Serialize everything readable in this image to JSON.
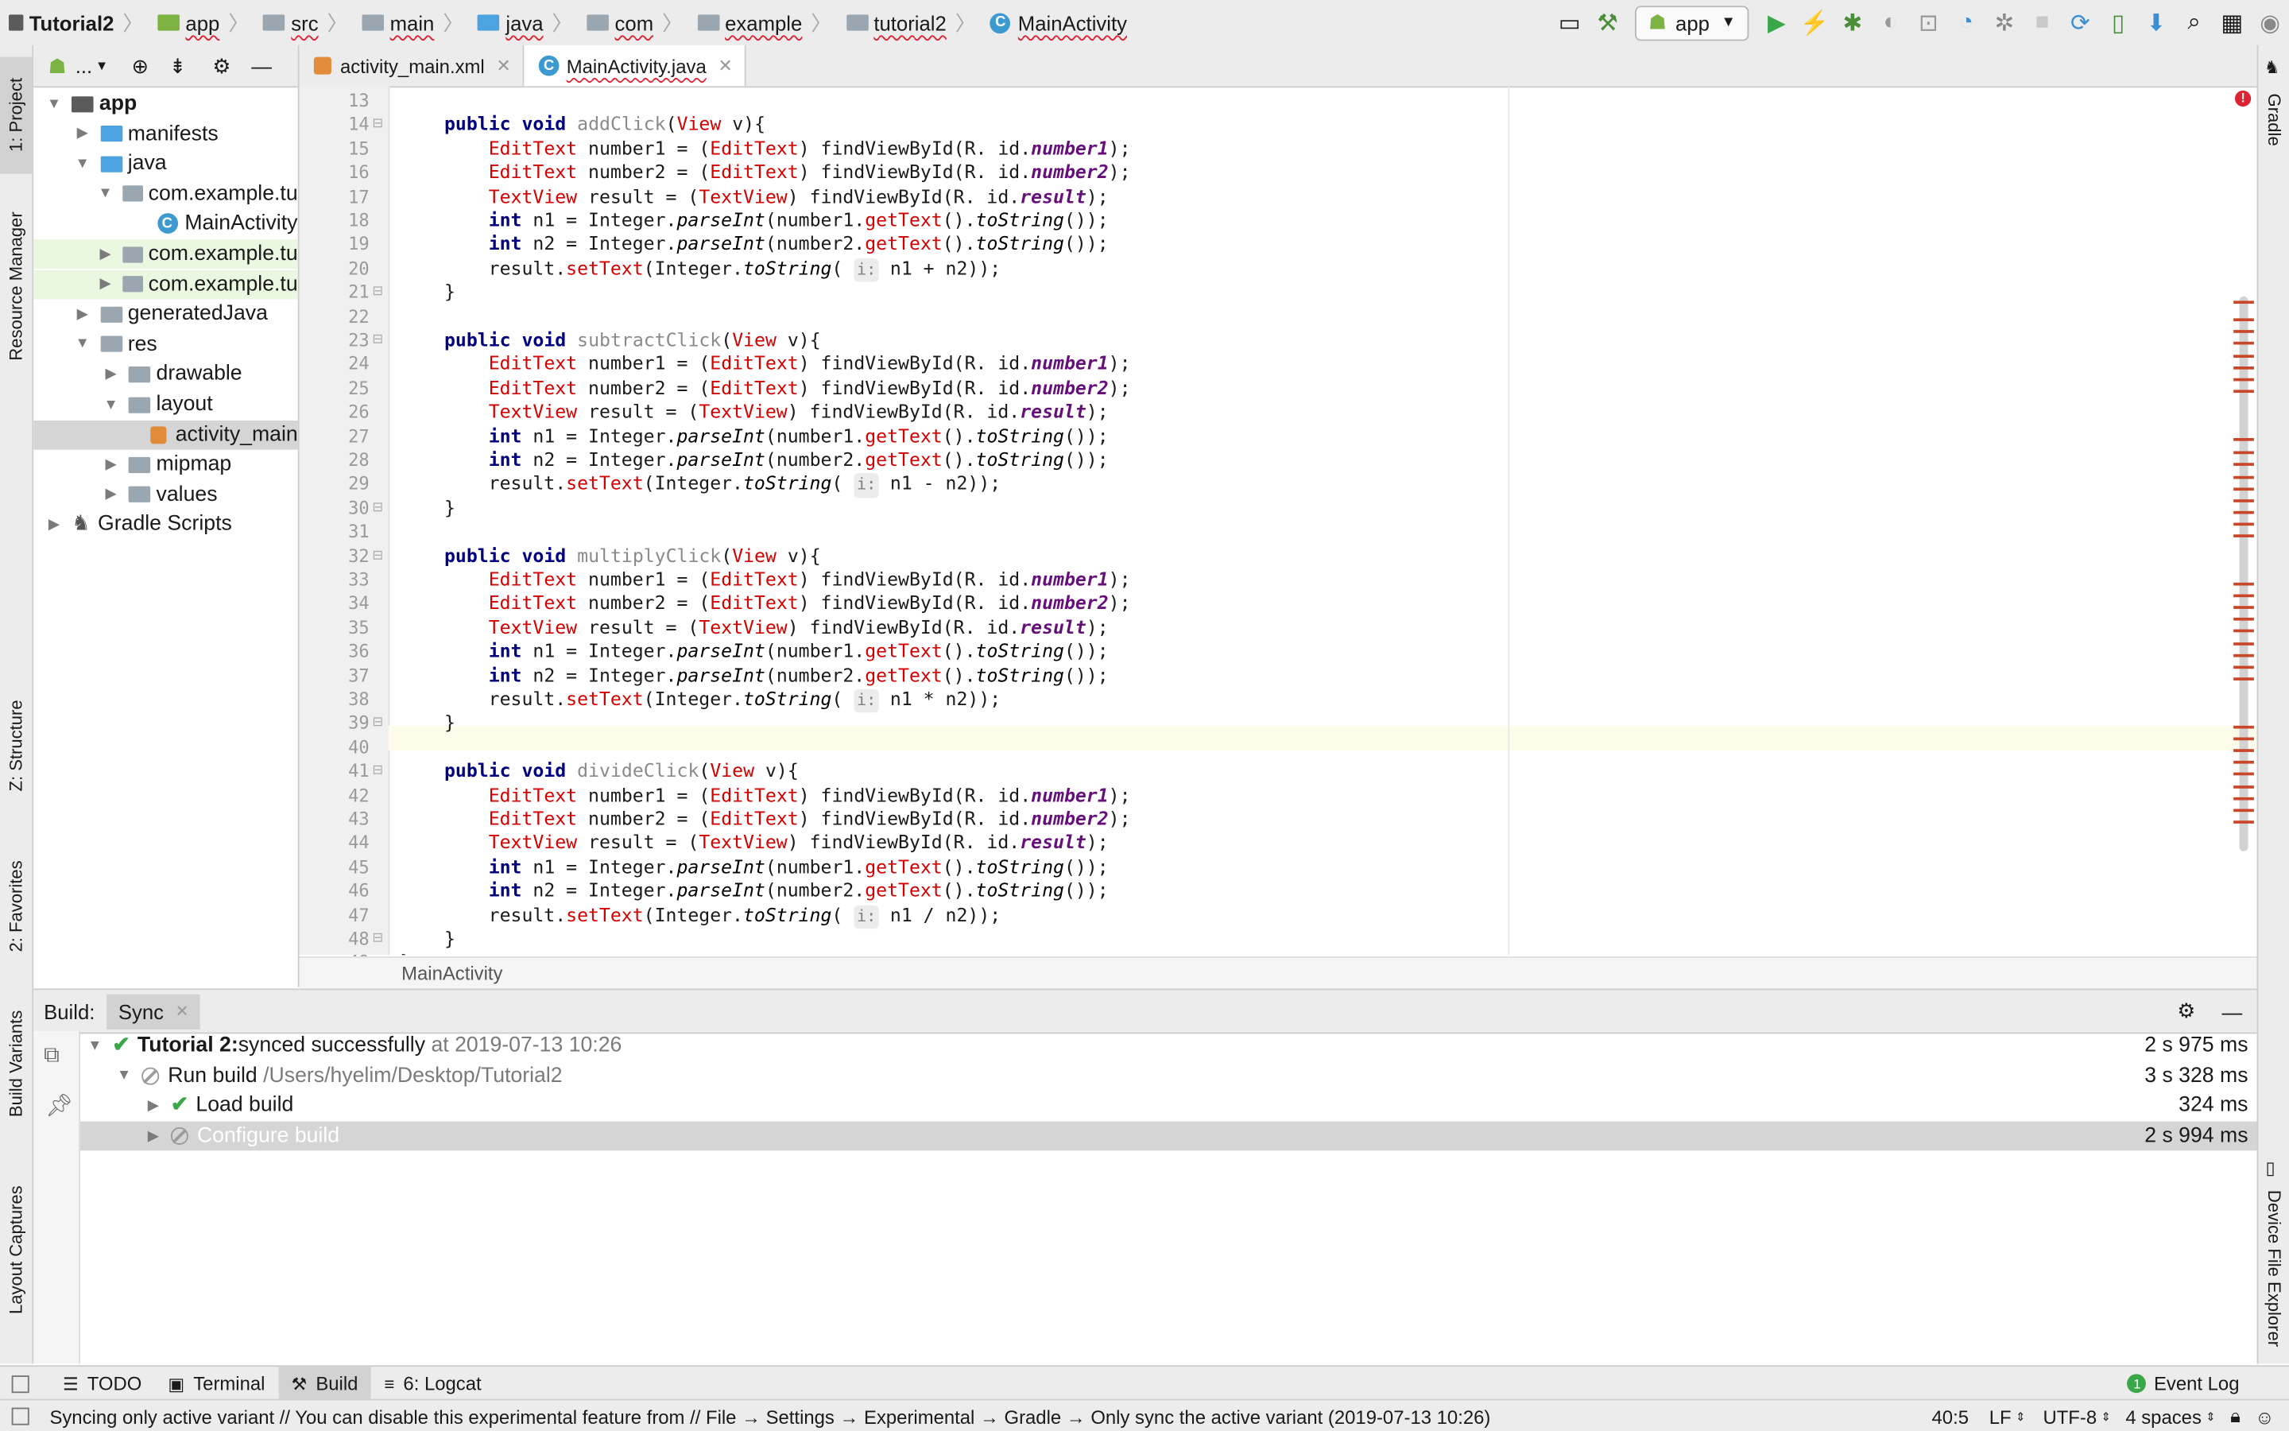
{
  "breadcrumbs": [
    "Tutorial2",
    "app",
    "src",
    "main",
    "java",
    "com",
    "example",
    "tutorial2",
    "MainActivity"
  ],
  "run_config": "app",
  "project_panel": {
    "header_dropdown": "...",
    "tree": [
      {
        "label": "app",
        "depth": 0,
        "expanded": true,
        "icon": "module-icon",
        "bold": true
      },
      {
        "label": "manifests",
        "depth": 1,
        "expanded": false,
        "icon": "folder-icon"
      },
      {
        "label": "java",
        "depth": 1,
        "expanded": true,
        "icon": "folder-icon"
      },
      {
        "label": "com.example.tu",
        "depth": 2,
        "expanded": true,
        "icon": "package-icon"
      },
      {
        "label": "MainActivity",
        "depth": 3,
        "icon": "class-icon"
      },
      {
        "label": "com.example.tu",
        "depth": 2,
        "expanded": false,
        "icon": "package-icon"
      },
      {
        "label": "com.example.tu",
        "depth": 2,
        "expanded": false,
        "icon": "package-icon"
      },
      {
        "label": "generatedJava",
        "depth": 1,
        "expanded": false,
        "icon": "folder-icon"
      },
      {
        "label": "res",
        "depth": 1,
        "expanded": true,
        "icon": "folder-icon"
      },
      {
        "label": "drawable",
        "depth": 2,
        "expanded": false,
        "icon": "folder-icon"
      },
      {
        "label": "layout",
        "depth": 2,
        "expanded": true,
        "icon": "folder-icon"
      },
      {
        "label": "activity_main",
        "depth": 3,
        "icon": "xml-icon",
        "selected": true
      },
      {
        "label": "mipmap",
        "depth": 2,
        "expanded": false,
        "icon": "folder-icon"
      },
      {
        "label": "values",
        "depth": 2,
        "expanded": false,
        "icon": "folder-icon"
      },
      {
        "label": "Gradle Scripts",
        "depth": 0,
        "expanded": false,
        "icon": "gradle-icon"
      }
    ]
  },
  "left_tool_tabs": [
    "1: Project",
    "Resource Manager",
    "Z: Structure",
    "2: Favorites",
    "Build Variants",
    "Layout Captures"
  ],
  "right_tool_tabs": [
    "Gradle",
    "Device File Explorer"
  ],
  "editor_tabs": [
    {
      "label": "activity_main.xml",
      "active": false
    },
    {
      "label": "MainActivity.java",
      "active": true
    }
  ],
  "code_start_line": 13,
  "code_lines": [
    "",
    "    public void addClick(View v){",
    "        EditText number1 = (EditText) findViewById(R. id.number1);",
    "        EditText number2 = (EditText) findViewById(R. id.number2);",
    "        TextView result = (TextView) findViewById(R. id.result);",
    "        int n1 = Integer.parseInt(number1.getText().toString());",
    "        int n2 = Integer.parseInt(number2.getText().toString());",
    "        result.setText(Integer.toString( i: n1 + n2));",
    "    }",
    "",
    "    public void subtractClick(View v){",
    "        EditText number1 = (EditText) findViewById(R. id.number1);",
    "        EditText number2 = (EditText) findViewById(R. id.number2);",
    "        TextView result = (TextView) findViewById(R. id.result);",
    "        int n1 = Integer.parseInt(number1.getText().toString());",
    "        int n2 = Integer.parseInt(number2.getText().toString());",
    "        result.setText(Integer.toString( i: n1 - n2));",
    "    }",
    "",
    "    public void multiplyClick(View v){",
    "        EditText number1 = (EditText) findViewById(R. id.number1);",
    "        EditText number2 = (EditText) findViewById(R. id.number2);",
    "        TextView result = (TextView) findViewById(R. id.result);",
    "        int n1 = Integer.parseInt(number1.getText().toString());",
    "        int n2 = Integer.parseInt(number2.getText().toString());",
    "        result.setText(Integer.toString( i: n1 * n2));",
    "    }",
    "",
    "    public void divideClick(View v){",
    "        EditText number1 = (EditText) findViewById(R. id.number1);",
    "        EditText number2 = (EditText) findViewById(R. id.number2);",
    "        TextView result = (TextView) findViewById(R. id.result);",
    "        int n1 = Integer.parseInt(number1.getText().toString());",
    "        int n2 = Integer.parseInt(number2.getText().toString());",
    "        result.setText(Integer.toString( i: n1 / n2));",
    "    }",
    "}"
  ],
  "editor_breadcrumb": "MainActivity",
  "build_panel": {
    "title": "Build:",
    "tab": "Sync",
    "rows": [
      {
        "depth": 0,
        "status": "success",
        "title": "Tutorial 2:",
        "text": " synced successfully",
        "detail": " at 2019-07-13 10:26",
        "time": "2 s 975 ms",
        "expanded": true
      },
      {
        "depth": 1,
        "status": "skipped",
        "title": "",
        "text": "Run build",
        "detail": " /Users/hyelim/Desktop/Tutorial2",
        "time": "3 s 328 ms",
        "expanded": true
      },
      {
        "depth": 2,
        "status": "success",
        "title": "",
        "text": "Load build",
        "detail": "",
        "time": "324 ms",
        "expanded": false
      },
      {
        "depth": 2,
        "status": "skipped",
        "title": "",
        "text": "Configure build",
        "detail": "",
        "time": "2 s 994 ms",
        "expanded": false,
        "selected": true
      }
    ]
  },
  "bottom_tabs": [
    {
      "label": "TODO",
      "icon": "list-icon",
      "active": false
    },
    {
      "label": "Terminal",
      "icon": "terminal-icon",
      "active": false
    },
    {
      "label": "Build",
      "icon": "hammer-icon",
      "active": true
    },
    {
      "label": "6: Logcat",
      "icon": "logcat-icon",
      "active": false
    }
  ],
  "event_log": {
    "label": "Event Log",
    "count": "1"
  },
  "status_bar": {
    "message": "Syncing only active variant // You can disable this experimental feature from // File → Settings → Experimental → Gradle → Only sync the active variant (2019-07-13 10:26)",
    "position": "40:5",
    "line_sep": "LF",
    "encoding": "UTF-8",
    "indent": "4 spaces"
  },
  "colors": {
    "keyword": "#000080",
    "type": "#d40000",
    "ident": "#660e7a",
    "accent_green": "#3aa84a",
    "run_green": "#3aa84a"
  }
}
